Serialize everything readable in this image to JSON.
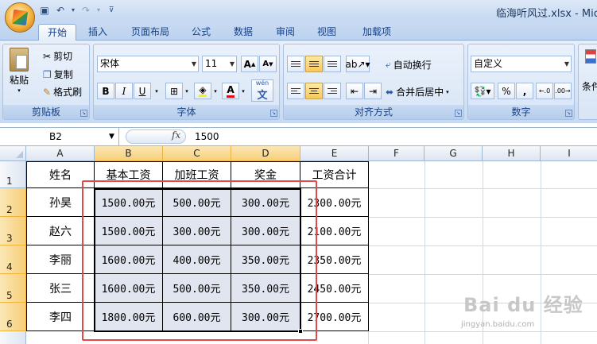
{
  "window": {
    "title": "临海听风过.xlsx - Micr"
  },
  "quick_access": [
    "save-icon",
    "undo-icon",
    "redo-icon",
    "customize-icon"
  ],
  "tabs": [
    "开始",
    "插入",
    "页面布局",
    "公式",
    "数据",
    "审阅",
    "视图",
    "加载项"
  ],
  "active_tab": "开始",
  "clipboard": {
    "label": "剪贴板",
    "paste": "粘贴",
    "cut": "剪切",
    "copy": "复制",
    "format_painter": "格式刷"
  },
  "font": {
    "label": "字体",
    "name": "宋体",
    "size": "11",
    "bold": "B",
    "italic": "I",
    "underline": "U",
    "grow": "A",
    "shrink": "A",
    "color_a": "A",
    "phonetic": "wén"
  },
  "align": {
    "label": "对齐方式",
    "wrap": "自动换行",
    "merge": "合并后居中"
  },
  "number": {
    "label": "数字",
    "format": "自定义",
    "percent": "%",
    "comma": ","
  },
  "styles": {
    "partial": "条件"
  },
  "formula_bar": {
    "name_box": "B2",
    "fx": "fx",
    "value": "1500"
  },
  "sheet": {
    "columns": [
      "A",
      "B",
      "C",
      "D",
      "E",
      "F",
      "G",
      "H",
      "I"
    ],
    "rows": [
      "1",
      "2",
      "3",
      "4",
      "5",
      "6"
    ],
    "header": [
      "姓名",
      "基本工资",
      "加班工资",
      "奖金",
      "工资合计"
    ],
    "data": [
      [
        "孙昊",
        "1500.00元",
        "500.00元",
        "300.00元",
        "2300.00元"
      ],
      [
        "赵六",
        "1500.00元",
        "300.00元",
        "300.00元",
        "2100.00元"
      ],
      [
        "李丽",
        "1600.00元",
        "400.00元",
        "350.00元",
        "2350.00元"
      ],
      [
        "张三",
        "1600.00元",
        "500.00元",
        "350.00元",
        "2450.00元"
      ],
      [
        "李四",
        "1800.00元",
        "600.00元",
        "300.00元",
        "2700.00元"
      ]
    ]
  },
  "watermark": {
    "brand": "Bai du 经验",
    "url": "jingyan.baidu.com"
  },
  "colors": {
    "accent": "#15428b",
    "selection_header": "#f7cf78",
    "selected_fill": "#e1e5f0",
    "annotation": "#e04a4a"
  }
}
